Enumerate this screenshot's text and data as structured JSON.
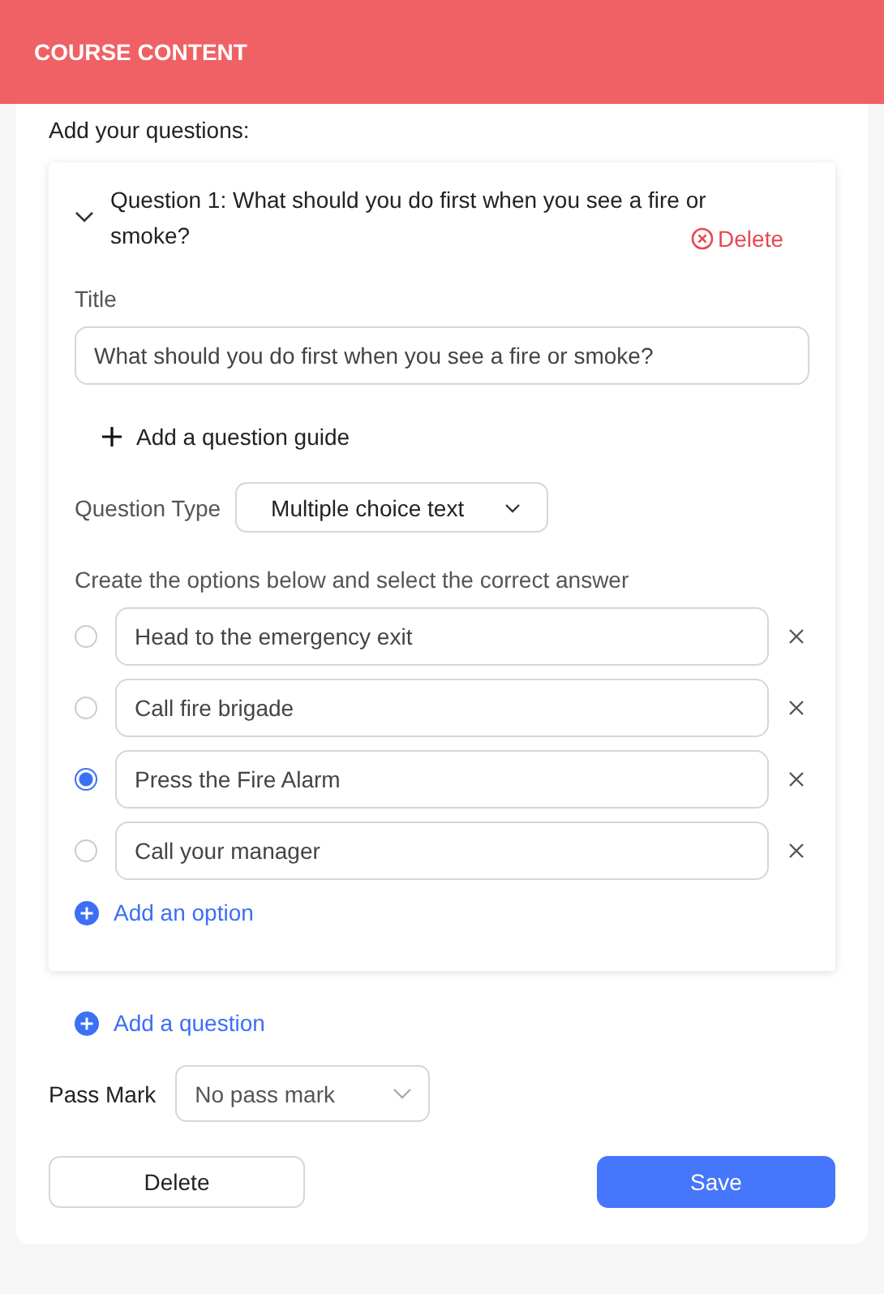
{
  "header": {
    "title": "COURSE CONTENT"
  },
  "section_label": "Add your questions:",
  "questions": [
    {
      "heading": "Question 1: What should you do first when you see a fire or smoke?",
      "expanded": true,
      "delete_label": "Delete",
      "title_label": "Title",
      "title_value": "What should you do first when you see a fire or smoke?",
      "guide_label": "Add a question guide",
      "type_label": "Question Type",
      "type_value": "Multiple choice text",
      "instructions": "Create the options below and select the correct answer",
      "options": [
        {
          "text": "Head to the emergency exit",
          "selected": false
        },
        {
          "text": "Call fire brigade",
          "selected": false
        },
        {
          "text": "Press the Fire Alarm",
          "selected": true
        },
        {
          "text": "Call your manager",
          "selected": false
        }
      ],
      "add_option_label": "Add an option"
    }
  ],
  "add_question_label": "Add a question",
  "pass_mark": {
    "label": "Pass Mark",
    "value": "No pass mark"
  },
  "buttons": {
    "delete": "Delete",
    "save": "Save"
  }
}
